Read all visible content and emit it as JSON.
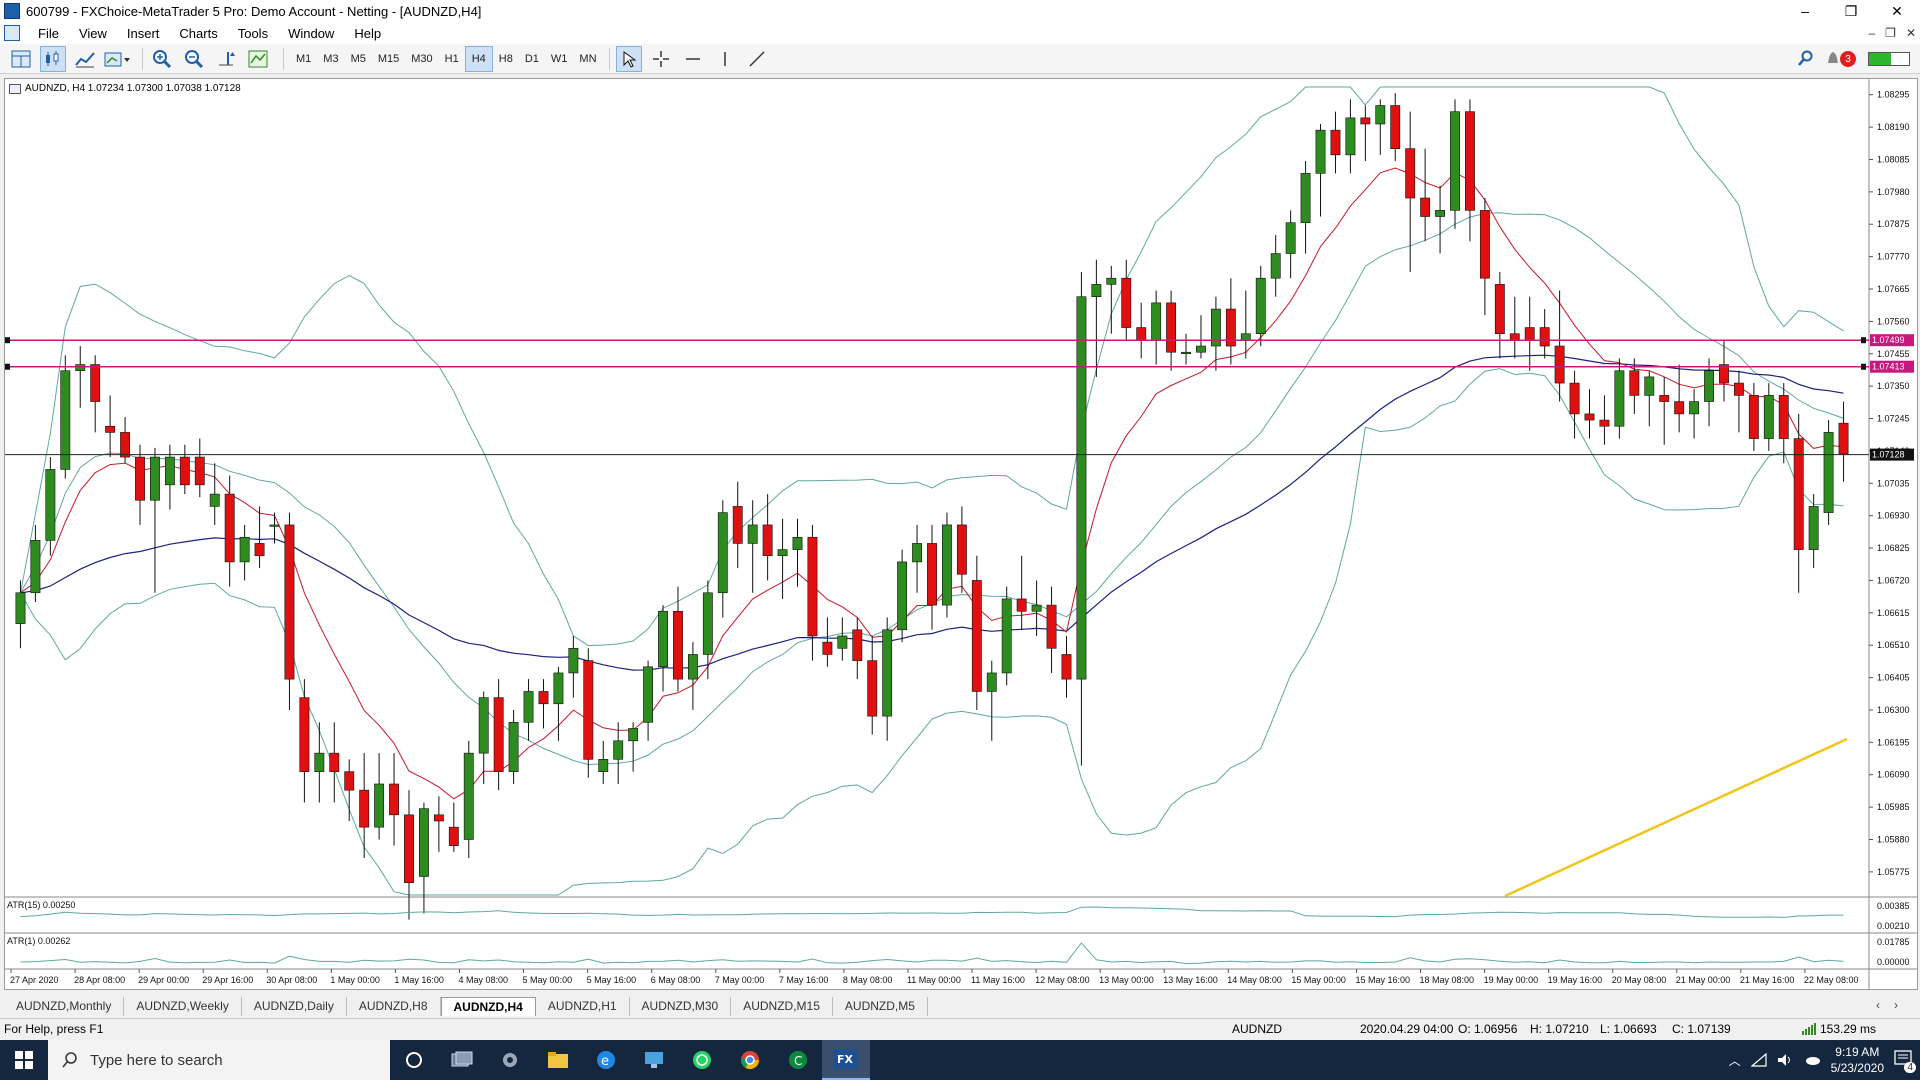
{
  "window": {
    "title": "600799 - FXChoice-MetaTrader 5 Pro: Demo Account - Netting - [AUDNZD,H4]",
    "buttons": [
      "–",
      "❐",
      "✕"
    ]
  },
  "menu": {
    "items": [
      "File",
      "View",
      "Insert",
      "Charts",
      "Tools",
      "Window",
      "Help"
    ]
  },
  "toolbar": {
    "timeframes": [
      "M1",
      "M3",
      "M5",
      "M15",
      "M30",
      "H1",
      "H4",
      "H8",
      "D1",
      "W1",
      "MN"
    ],
    "active_timeframe": "H4",
    "notification_count": "3"
  },
  "chart": {
    "symbol_header": "AUDNZD, H4  1.07234 1.07300 1.07038 1.07128",
    "current_price_label": "1.07128",
    "hline_labels": [
      "1.07499",
      "1.07413"
    ],
    "price_labels": [
      "1.08295",
      "1.08190",
      "1.08085",
      "1.07980",
      "1.07875",
      "1.07770",
      "1.07665",
      "1.07560",
      "1.07455",
      "1.07350",
      "1.07245",
      "1.07140",
      "1.07035",
      "1.06930",
      "1.06825",
      "1.06720",
      "1.06615",
      "1.06510",
      "1.06405",
      "1.06300",
      "1.06195",
      "1.06090",
      "1.05985",
      "1.05880",
      "1.05775"
    ],
    "atr15": {
      "label": "ATR(15) 0.00250",
      "scale": [
        "0.00385",
        "0.00210"
      ]
    },
    "atr1": {
      "label": "ATR(1) 0.00262",
      "scale": [
        "0.01785",
        "0.00000"
      ]
    },
    "time_labels": [
      "27 Apr 2020",
      "28 Apr 08:00",
      "29 Apr 00:00",
      "29 Apr 16:00",
      "30 Apr 08:00",
      "1 May 00:00",
      "1 May 16:00",
      "4 May 08:00",
      "5 May 00:00",
      "5 May 16:00",
      "6 May 08:00",
      "7 May 00:00",
      "7 May 16:00",
      "8 May 08:00",
      "11 May 00:00",
      "11 May 16:00",
      "12 May 08:00",
      "13 May 00:00",
      "13 May 16:00",
      "14 May 08:00",
      "15 May 00:00",
      "15 May 16:00",
      "18 May 08:00",
      "19 May 00:00",
      "19 May 16:00",
      "20 May 08:00",
      "21 May 00:00",
      "21 May 16:00",
      "22 May 08:00"
    ],
    "colors": {
      "bull": "#2e8b1f",
      "bear": "#e01010",
      "hline": "#c8187e",
      "bollinger": "#5fa8a0",
      "ema_fast": "#c8182a",
      "ema_slow": "#1a237e",
      "ma_long": "#f0c419"
    }
  },
  "chart_data": {
    "type": "candlestick",
    "symbol": "AUDNZD",
    "timeframe": "H4",
    "ohlc": [
      [
        1.0658,
        1.0672,
        1.065,
        1.0668
      ],
      [
        1.0668,
        1.069,
        1.0665,
        1.0685
      ],
      [
        1.0685,
        1.0712,
        1.068,
        1.0708
      ],
      [
        1.0708,
        1.0745,
        1.0705,
        1.074
      ],
      [
        1.074,
        1.0748,
        1.0728,
        1.0742
      ],
      [
        1.0742,
        1.0745,
        1.072,
        1.073
      ],
      [
        1.0722,
        1.0732,
        1.0712,
        1.072
      ],
      [
        1.072,
        1.0725,
        1.071,
        1.0712
      ],
      [
        1.0712,
        1.0716,
        1.069,
        1.0698
      ],
      [
        1.0698,
        1.0715,
        1.0668,
        1.0712
      ],
      [
        1.0703,
        1.0716,
        1.0695,
        1.0712
      ],
      [
        1.0712,
        1.0716,
        1.07,
        1.0703
      ],
      [
        1.0712,
        1.0718,
        1.0699,
        1.0703
      ],
      [
        1.0696,
        1.071,
        1.069,
        1.07
      ],
      [
        1.07,
        1.0706,
        1.067,
        1.0678
      ],
      [
        1.0678,
        1.069,
        1.0672,
        1.0686
      ],
      [
        1.0684,
        1.0696,
        1.0676,
        1.068
      ],
      [
        1.069,
        1.0694,
        1.0684,
        1.069
      ],
      [
        1.069,
        1.0694,
        1.063,
        1.064
      ],
      [
        1.0634,
        1.064,
        1.06,
        1.061
      ],
      [
        1.061,
        1.0626,
        1.06,
        1.0616
      ],
      [
        1.0616,
        1.0626,
        1.06,
        1.061
      ],
      [
        1.061,
        1.0614,
        1.0594,
        1.0604
      ],
      [
        1.0604,
        1.0616,
        1.0582,
        1.0592
      ],
      [
        1.0592,
        1.0616,
        1.0588,
        1.0606
      ],
      [
        1.0606,
        1.0616,
        1.0586,
        1.0596
      ],
      [
        1.0596,
        1.0604,
        1.0562,
        1.0574
      ],
      [
        1.0576,
        1.06,
        1.0564,
        1.0598
      ],
      [
        1.0596,
        1.0602,
        1.0584,
        1.0594
      ],
      [
        1.0592,
        1.06,
        1.0584,
        1.0586
      ],
      [
        1.0588,
        1.062,
        1.0582,
        1.0616
      ],
      [
        1.0616,
        1.0636,
        1.0606,
        1.0634
      ],
      [
        1.0634,
        1.064,
        1.0604,
        1.061
      ],
      [
        1.061,
        1.063,
        1.0606,
        1.0626
      ],
      [
        1.0626,
        1.064,
        1.062,
        1.0636
      ],
      [
        1.0636,
        1.064,
        1.0624,
        1.0632
      ],
      [
        1.0632,
        1.0644,
        1.062,
        1.0642
      ],
      [
        1.0642,
        1.0654,
        1.0634,
        1.065
      ],
      [
        1.0646,
        1.065,
        1.0608,
        1.0614
      ],
      [
        1.061,
        1.062,
        1.0606,
        1.0614
      ],
      [
        1.0614,
        1.0626,
        1.0606,
        1.062
      ],
      [
        1.062,
        1.0626,
        1.061,
        1.0624
      ],
      [
        1.0626,
        1.0646,
        1.062,
        1.0644
      ],
      [
        1.0644,
        1.0664,
        1.0636,
        1.0662
      ],
      [
        1.0662,
        1.067,
        1.0636,
        1.064
      ],
      [
        1.064,
        1.0652,
        1.063,
        1.0648
      ],
      [
        1.0648,
        1.0672,
        1.064,
        1.0668
      ],
      [
        1.0668,
        1.0698,
        1.066,
        1.0694
      ],
      [
        1.0696,
        1.0704,
        1.0676,
        1.0684
      ],
      [
        1.0684,
        1.0698,
        1.0668,
        1.069
      ],
      [
        1.069,
        1.07,
        1.0672,
        1.068
      ],
      [
        1.068,
        1.0692,
        1.0666,
        1.0682
      ],
      [
        1.0682,
        1.0692,
        1.067,
        1.0686
      ],
      [
        1.0686,
        1.069,
        1.0646,
        1.0654
      ],
      [
        1.0652,
        1.066,
        1.0644,
        1.0648
      ],
      [
        1.065,
        1.066,
        1.0646,
        1.0654
      ],
      [
        1.0656,
        1.066,
        1.064,
        1.0646
      ],
      [
        1.0646,
        1.0654,
        1.0622,
        1.0628
      ],
      [
        1.0628,
        1.066,
        1.062,
        1.0656
      ],
      [
        1.0656,
        1.0682,
        1.0652,
        1.0678
      ],
      [
        1.0678,
        1.069,
        1.0668,
        1.0684
      ],
      [
        1.0684,
        1.069,
        1.0656,
        1.0664
      ],
      [
        1.0664,
        1.0694,
        1.066,
        1.069
      ],
      [
        1.069,
        1.0696,
        1.0668,
        1.0674
      ],
      [
        1.0672,
        1.068,
        1.063,
        1.0636
      ],
      [
        1.0636,
        1.0646,
        1.062,
        1.0642
      ],
      [
        1.0642,
        1.067,
        1.0638,
        1.0666
      ],
      [
        1.0666,
        1.068,
        1.0656,
        1.0662
      ],
      [
        1.0662,
        1.0672,
        1.0654,
        1.0664
      ],
      [
        1.0664,
        1.067,
        1.0642,
        1.065
      ],
      [
        1.0648,
        1.0654,
        1.0634,
        1.064
      ],
      [
        1.064,
        1.0772,
        1.0612,
        1.0764
      ],
      [
        1.0764,
        1.0776,
        1.0738,
        1.0768
      ],
      [
        1.0768,
        1.0774,
        1.0752,
        1.077
      ],
      [
        1.077,
        1.0776,
        1.075,
        1.0754
      ],
      [
        1.0754,
        1.0762,
        1.0744,
        1.075
      ],
      [
        1.075,
        1.0766,
        1.0742,
        1.0762
      ],
      [
        1.0762,
        1.0766,
        1.074,
        1.0746
      ],
      [
        1.0746,
        1.0752,
        1.0742,
        1.0746
      ],
      [
        1.0746,
        1.0758,
        1.0744,
        1.0748
      ],
      [
        1.0748,
        1.0764,
        1.074,
        1.076
      ],
      [
        1.076,
        1.077,
        1.0742,
        1.0748
      ],
      [
        1.075,
        1.0766,
        1.0744,
        1.0752
      ],
      [
        1.0752,
        1.0774,
        1.0748,
        1.077
      ],
      [
        1.077,
        1.0784,
        1.0764,
        1.0778
      ],
      [
        1.0778,
        1.0792,
        1.077,
        1.0788
      ],
      [
        1.0788,
        1.0808,
        1.0778,
        1.0804
      ],
      [
        1.0804,
        1.082,
        1.079,
        1.0818
      ],
      [
        1.0818,
        1.0824,
        1.0804,
        1.081
      ],
      [
        1.081,
        1.0828,
        1.0804,
        1.0822
      ],
      [
        1.0822,
        1.0826,
        1.0808,
        1.082
      ],
      [
        1.082,
        1.0828,
        1.081,
        1.0826
      ],
      [
        1.0826,
        1.083,
        1.0808,
        1.0812
      ],
      [
        1.0812,
        1.0824,
        1.0772,
        1.0796
      ],
      [
        1.0796,
        1.0812,
        1.0782,
        1.079
      ],
      [
        1.079,
        1.08,
        1.0778,
        1.0792
      ],
      [
        1.0792,
        1.0828,
        1.0786,
        1.0824
      ],
      [
        1.0824,
        1.0828,
        1.0782,
        1.0792
      ],
      [
        1.0792,
        1.0796,
        1.0758,
        1.077
      ],
      [
        1.0768,
        1.0772,
        1.0744,
        1.0752
      ],
      [
        1.0752,
        1.0764,
        1.0744,
        1.075
      ],
      [
        1.0754,
        1.0764,
        1.074,
        1.075
      ],
      [
        1.0754,
        1.076,
        1.0744,
        1.0748
      ],
      [
        1.0748,
        1.0766,
        1.073,
        1.0736
      ],
      [
        1.0736,
        1.074,
        1.0718,
        1.0726
      ],
      [
        1.0726,
        1.0734,
        1.0718,
        1.0724
      ],
      [
        1.0724,
        1.0732,
        1.0716,
        1.0722
      ],
      [
        1.0722,
        1.0744,
        1.0718,
        1.074
      ],
      [
        1.074,
        1.0744,
        1.0726,
        1.0732
      ],
      [
        1.0732,
        1.074,
        1.0722,
        1.0738
      ],
      [
        1.0732,
        1.0738,
        1.0716,
        1.073
      ],
      [
        1.073,
        1.0742,
        1.072,
        1.0726
      ],
      [
        1.0726,
        1.0734,
        1.0718,
        1.073
      ],
      [
        1.073,
        1.0744,
        1.0722,
        1.074
      ],
      [
        1.0742,
        1.075,
        1.073,
        1.0736
      ],
      [
        1.0736,
        1.074,
        1.072,
        1.0732
      ],
      [
        1.0732,
        1.0736,
        1.0714,
        1.0718
      ],
      [
        1.0718,
        1.0736,
        1.0714,
        1.0732
      ],
      [
        1.0732,
        1.0736,
        1.071,
        1.0718
      ],
      [
        1.0718,
        1.0726,
        1.0668,
        1.0682
      ],
      [
        1.0682,
        1.07,
        1.0676,
        1.0696
      ],
      [
        1.0694,
        1.0724,
        1.069,
        1.072
      ],
      [
        1.0723,
        1.073,
        1.0704,
        1.0713
      ]
    ],
    "levels": [
      1.07499,
      1.07413
    ],
    "current_price": 1.07128,
    "ylim": [
      1.057,
      1.0832
    ],
    "grid": false
  },
  "tabs": [
    "AUDNZD,Monthly",
    "AUDNZD,Weekly",
    "AUDNZD,Daily",
    "AUDNZD,H8",
    "AUDNZD,H4",
    "AUDNZD,H1",
    "AUDNZD,M30",
    "AUDNZD,M15",
    "AUDNZD,M5"
  ],
  "active_tab": "AUDNZD,H4",
  "status": {
    "help": "For Help, press F1",
    "symbol": "AUDNZD",
    "datetime": "2020.04.29 04:00",
    "open": "O: 1.06956",
    "high": "H: 1.07210",
    "low": "L: 1.06693",
    "close": "C: 1.07139",
    "ping": "153.29 ms"
  },
  "taskbar": {
    "search_placeholder": "Type here to search",
    "time": "9:19 AM",
    "date": "5/23/2020",
    "notif_count": "4"
  }
}
